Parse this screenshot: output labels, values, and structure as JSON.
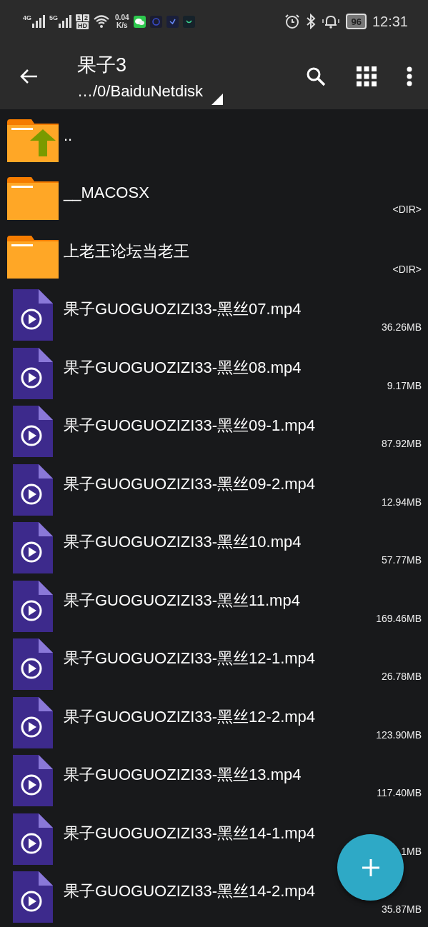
{
  "status_bar": {
    "signals": [
      "4G",
      "5G"
    ],
    "sim_labels": [
      "1",
      "2"
    ],
    "hd": "HD",
    "speed": "0.04",
    "speed_unit": "K/s",
    "battery": "96",
    "time": "12:31"
  },
  "toolbar": {
    "title": "果子3",
    "path": "…/0/BaiduNetdisk"
  },
  "files": [
    {
      "kind": "up",
      "name": ".."
    },
    {
      "kind": "folder",
      "name": "__MACOSX",
      "size": "<DIR>"
    },
    {
      "kind": "folder",
      "name": "上老王论坛当老王",
      "size": "<DIR>"
    },
    {
      "kind": "video",
      "name": "果子GUOGUOZIZI33-黑丝07.mp4",
      "size": "36.26MB"
    },
    {
      "kind": "video",
      "name": "果子GUOGUOZIZI33-黑丝08.mp4",
      "size": "9.17MB"
    },
    {
      "kind": "video",
      "name": "果子GUOGUOZIZI33-黑丝09-1.mp4",
      "size": "87.92MB"
    },
    {
      "kind": "video",
      "name": "果子GUOGUOZIZI33-黑丝09-2.mp4",
      "size": "12.94MB"
    },
    {
      "kind": "video",
      "name": "果子GUOGUOZIZI33-黑丝10.mp4",
      "size": "57.77MB"
    },
    {
      "kind": "video",
      "name": "果子GUOGUOZIZI33-黑丝11.mp4",
      "size": "169.46MB"
    },
    {
      "kind": "video",
      "name": "果子GUOGUOZIZI33-黑丝12-1.mp4",
      "size": "26.78MB"
    },
    {
      "kind": "video",
      "name": "果子GUOGUOZIZI33-黑丝12-2.mp4",
      "size": "123.90MB"
    },
    {
      "kind": "video",
      "name": "果子GUOGUOZIZI33-黑丝13.mp4",
      "size": "117.40MB"
    },
    {
      "kind": "video",
      "name": "果子GUOGUOZIZI33-黑丝14-1.mp4",
      "size": "1MB"
    },
    {
      "kind": "video",
      "name": "果子GUOGUOZIZI33-黑丝14-2.mp4",
      "size": "35.87MB"
    }
  ]
}
